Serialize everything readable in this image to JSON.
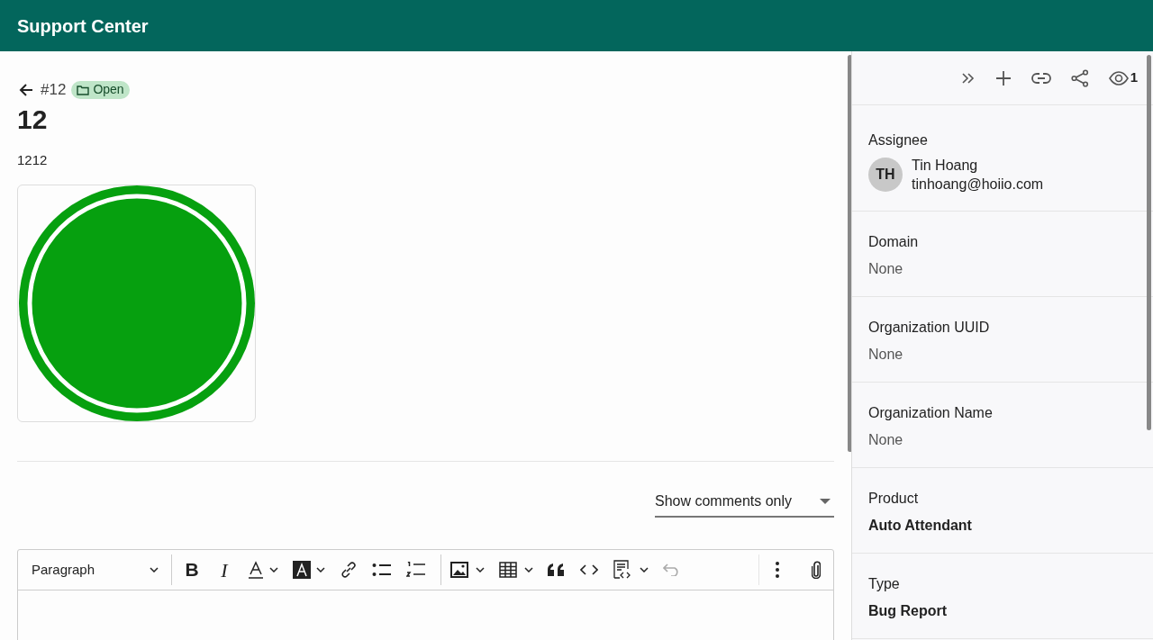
{
  "app_bar": {
    "title": "Support Center"
  },
  "ticket": {
    "number": "#12",
    "status": "Open",
    "title": "12",
    "description": "1212"
  },
  "comments_filter": {
    "value": "Show comments only"
  },
  "editor": {
    "format": "Paragraph",
    "bold_label": "B",
    "italic_label": "I",
    "undo_disabled": true
  },
  "sidebar": {
    "watchers": "1",
    "fields": [
      {
        "kind": "person",
        "label": "Assignee",
        "initials": "TH",
        "name": "Tin Hoang",
        "email": "tinhoang@hoiio.com"
      },
      {
        "kind": "empty",
        "label": "Domain",
        "value": "None"
      },
      {
        "kind": "empty",
        "label": "Organization UUID",
        "value": "None"
      },
      {
        "kind": "empty",
        "label": "Organization Name",
        "value": "None"
      },
      {
        "kind": "value",
        "label": "Product",
        "value": "Auto Attendant"
      },
      {
        "kind": "value",
        "label": "Type",
        "value": "Bug Report"
      }
    ]
  }
}
